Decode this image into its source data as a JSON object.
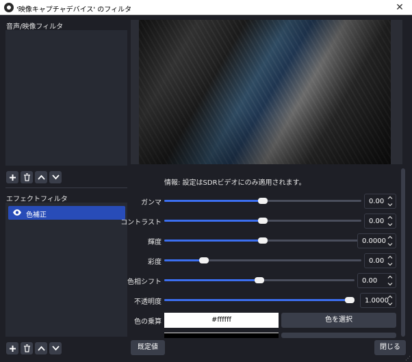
{
  "window": {
    "title": "'映像キャプチャデバイス' のフィルタ",
    "close_symbol": "✕"
  },
  "left": {
    "audio_video_title": "音声/映像フィルタ",
    "effect_title": "エフェクトフィルタ",
    "effect_items": [
      {
        "label": "色補正",
        "visible": true
      }
    ]
  },
  "info_text": "情報: 設定はSDRビデオにのみ適用されます。",
  "properties": [
    {
      "label": "ガンマ",
      "value": "0.00",
      "level": 0.5
    },
    {
      "label": "コントラスト",
      "value": "0.00",
      "level": 0.5
    },
    {
      "label": "輝度",
      "value": "0.0000",
      "level": 0.5
    },
    {
      "label": "彩度",
      "value": "0.00",
      "level": 0.2
    },
    {
      "label": "色相シフト",
      "value": "0.00",
      "level": 0.5
    },
    {
      "label": "不透明度",
      "value": "1.0000",
      "level": 1.0
    }
  ],
  "color": {
    "label": "色の乗算",
    "hex": "#ffffff",
    "select_button": "色を選択"
  },
  "buttons": {
    "defaults": "既定値",
    "close": "閉じる"
  },
  "colors": {
    "accent": "#3c6ff0",
    "selection": "#284cb8",
    "background": "#1e1f26"
  }
}
